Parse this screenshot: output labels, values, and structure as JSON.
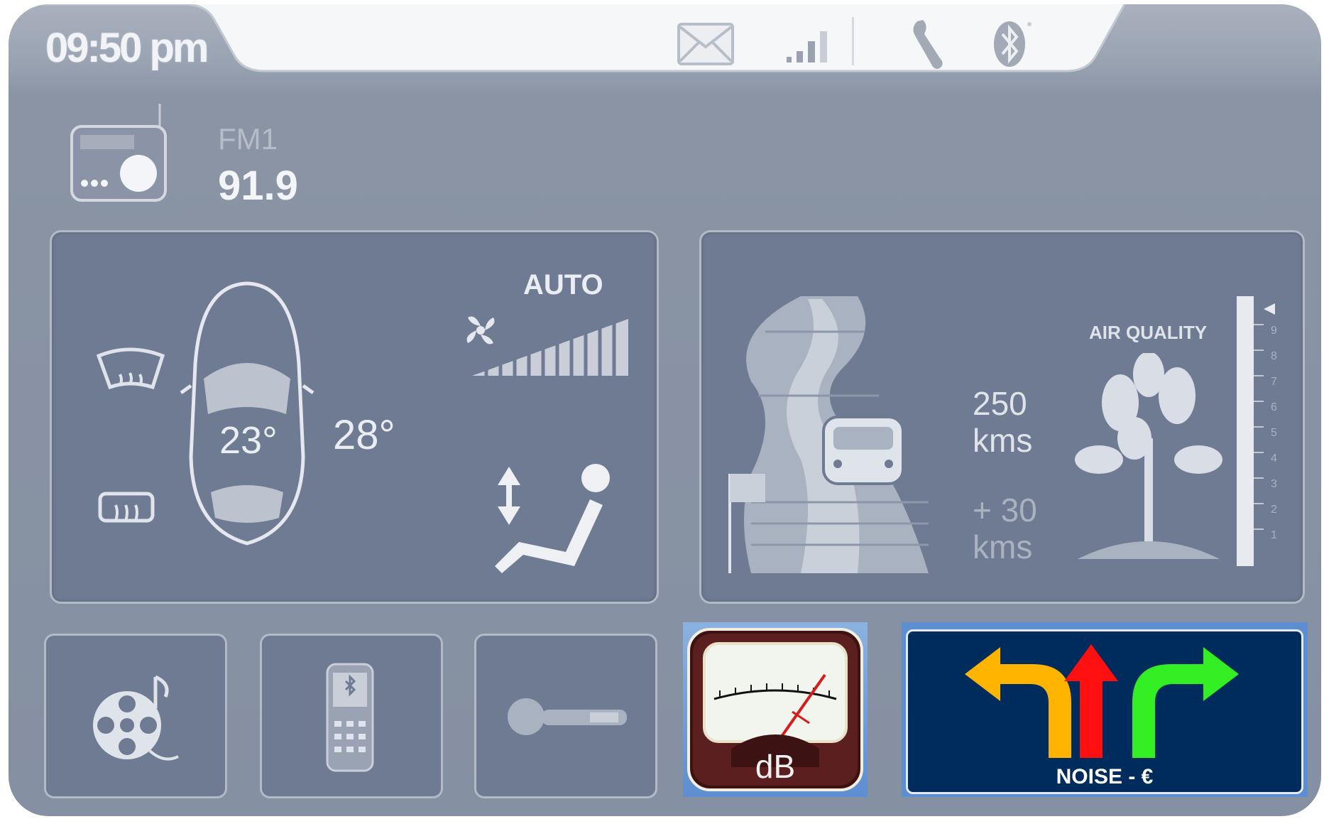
{
  "status_bar": {
    "time": "09:50 pm",
    "icons": [
      "mail-icon",
      "signal-icon",
      "wrench-icon",
      "bluetooth-icon"
    ]
  },
  "radio": {
    "icon": "radio-icon",
    "band": "FM1",
    "frequency": "91.9"
  },
  "climate": {
    "fan_mode": "AUTO",
    "inside_temp": "23°",
    "outside_temp": "28°",
    "icons": [
      "windshield-defrost-icon",
      "rear-defrost-icon",
      "car-top-icon",
      "fan-icon",
      "seat-adjust-icon"
    ]
  },
  "trip": {
    "range_value": "250",
    "range_unit": "kms",
    "extra_value": "+ 30",
    "extra_unit": "kms",
    "air_quality_label": "AIR QUALITY",
    "scale": [
      "9",
      "8",
      "7",
      "6",
      "5",
      "4",
      "3",
      "2",
      "1"
    ],
    "icons": [
      "road-icon",
      "tree-icon"
    ]
  },
  "shortcuts": [
    {
      "name": "media",
      "icon": "film-music-icon"
    },
    {
      "name": "phone",
      "icon": "bluetooth-phone-icon"
    },
    {
      "name": "key",
      "icon": "key-icon"
    }
  ],
  "noise_meter": {
    "unit": "dB",
    "icon": "decibel-meter-icon"
  },
  "navigation": {
    "label": "NOISE - €",
    "icon": "direction-arrows-icon",
    "colors": {
      "left": "#ffb400",
      "straight": "#ff1010",
      "right": "#33ee22",
      "background": "#002c5d"
    }
  }
}
